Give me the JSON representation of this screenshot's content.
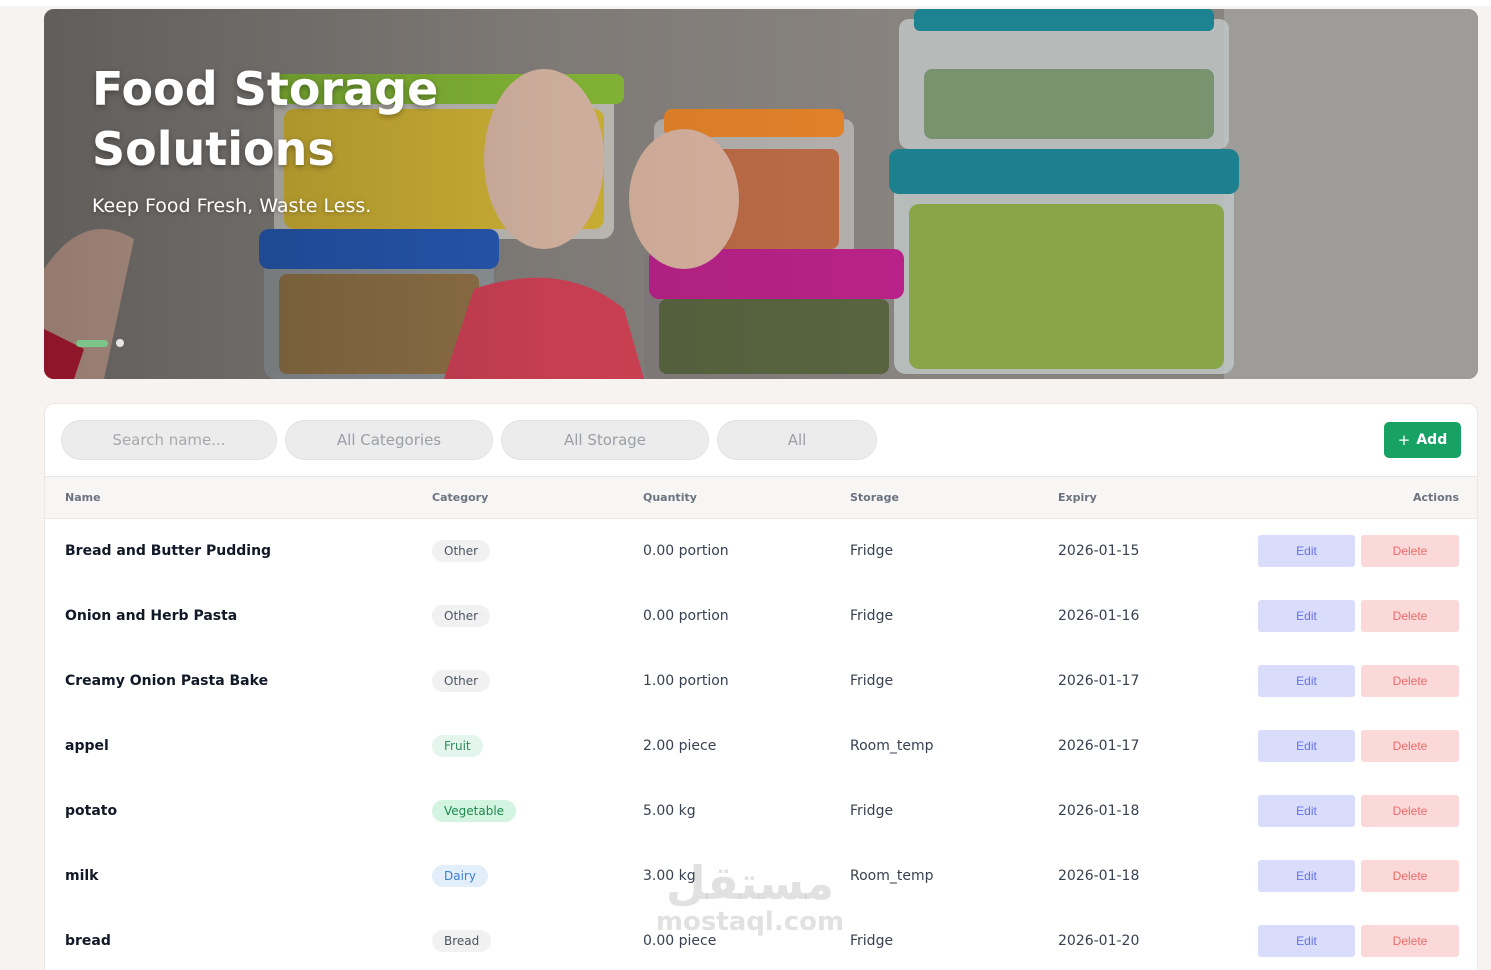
{
  "hero": {
    "title": "Food Storage Solutions",
    "subtitle": "Keep Food Fresh, Waste Less.",
    "slides_total": 2,
    "slide_active": 1
  },
  "toolbar": {
    "search_placeholder": "Search name...",
    "category_filter": "All Categories",
    "storage_filter": "All Storage",
    "status_filter": "All",
    "add_label": "Add",
    "add_icon": "plus-icon"
  },
  "table": {
    "headers": {
      "name": "Name",
      "category": "Category",
      "quantity": "Quantity",
      "storage": "Storage",
      "expiry": "Expiry",
      "actions": "Actions"
    },
    "edit_label": "Edit",
    "delete_label": "Delete",
    "rows": [
      {
        "name": "Bread and Butter Pudding",
        "category": "Other",
        "quantity": "0.00 portion",
        "storage": "Fridge",
        "expiry": "2026-01-15"
      },
      {
        "name": "Onion and Herb Pasta",
        "category": "Other",
        "quantity": "0.00 portion",
        "storage": "Fridge",
        "expiry": "2026-01-16"
      },
      {
        "name": "Creamy Onion Pasta Bake",
        "category": "Other",
        "quantity": "1.00 portion",
        "storage": "Fridge",
        "expiry": "2026-01-17"
      },
      {
        "name": "appel",
        "category": "Fruit",
        "quantity": "2.00 piece",
        "storage": "Room_temp",
        "expiry": "2026-01-17"
      },
      {
        "name": "potato",
        "category": "Vegetable",
        "quantity": "5.00 kg",
        "storage": "Fridge",
        "expiry": "2026-01-18"
      },
      {
        "name": "milk",
        "category": "Dairy",
        "quantity": "3.00 kg",
        "storage": "Room_temp",
        "expiry": "2026-01-18"
      },
      {
        "name": "bread",
        "category": "Bread",
        "quantity": "0.00 piece",
        "storage": "Fridge",
        "expiry": "2026-01-20"
      }
    ]
  },
  "category_colors": {
    "Other": {
      "bg": "#f1f1f1",
      "fg": "#4b5563"
    },
    "Fruit": {
      "bg": "#e3f5ec",
      "fg": "#2f8a5b"
    },
    "Vegetable": {
      "bg": "#d3f4e0",
      "fg": "#1f8a4c"
    },
    "Dairy": {
      "bg": "#e3eefb",
      "fg": "#3b7fd0"
    },
    "Bread": {
      "bg": "#f1f1f1",
      "fg": "#4b5563"
    }
  },
  "colors": {
    "accent": "#17a163",
    "edit_bg": "#d9dcfb",
    "delete_bg": "#fbd9d9"
  },
  "watermark": {
    "arabic": "مستقل",
    "latin": "mostaql.com"
  }
}
